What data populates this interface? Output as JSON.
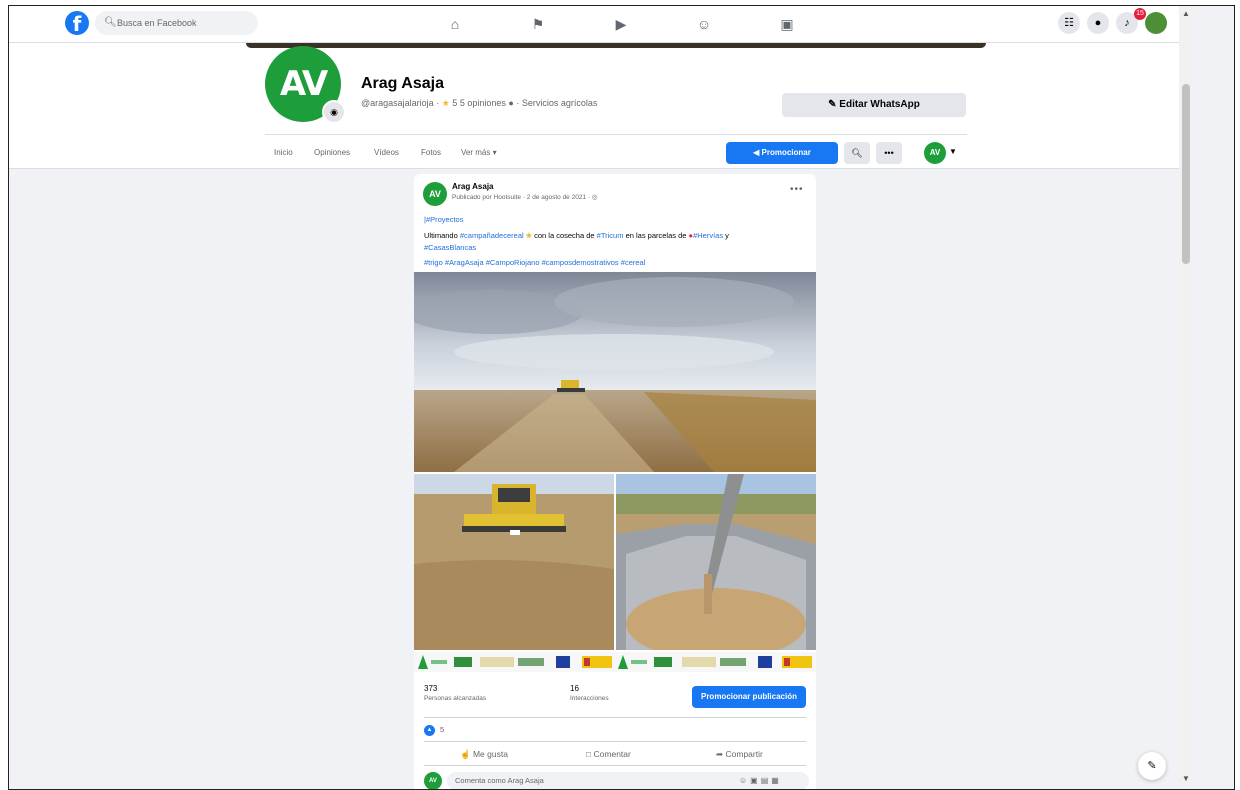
{
  "topbar": {
    "search_placeholder": "Busca en Facebook",
    "notifications_badge": "15"
  },
  "page": {
    "name": "Arag Asaja",
    "handle": "@aragasajalarioja",
    "rating": "5",
    "reviews": "5 opiniones",
    "category": "Servicios agrícolas",
    "logo_letters": "AV",
    "whatsapp_label": "Editar WhatsApp",
    "tabs": [
      "Inicio",
      "Opiniones",
      "Vídeos",
      "Fotos",
      "Ver más"
    ],
    "promote_label": "Promocionar"
  },
  "post": {
    "author": "Arag Asaja",
    "meta": "Publicado por Hootsuite · 2 de agosto de 2021 ·",
    "line1": "|#Proyectos",
    "line2_pre": "Ultimando ",
    "line2_tag1": "#campañadecereal",
    "line2_mid": " con la cosecha de ",
    "line2_tag2": "#Tricum",
    "line2_mid2": " en las parcelas de ",
    "line2_tag3": "#Hervías",
    "line2_post": " y",
    "line3": "#CasasBlancas",
    "line4": "#trigo #AragAsaja #CampoRiojano #camposdemostrativos #cereal",
    "reach_value": "373",
    "reach_label": "Personas alcanzadas",
    "interactions_value": "16",
    "interactions_label": "Interacciones",
    "promote_post_label": "Promocionar publicación",
    "likes_count": "5",
    "like_label": "Me gusta",
    "comment_label": "Comentar",
    "share_label": "Compartir",
    "comment_placeholder": "Comenta como Arag Asaja"
  }
}
